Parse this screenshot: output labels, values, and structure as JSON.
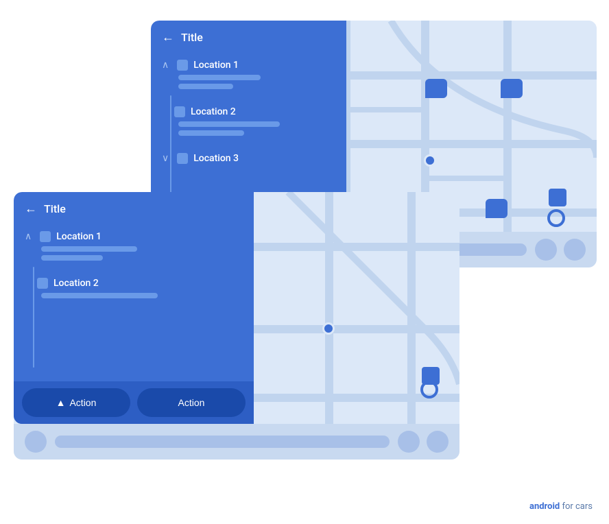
{
  "back_card": {
    "title": "Title",
    "panel": {
      "locations": [
        {
          "name": "Location 1",
          "bars": [
            120,
            80
          ],
          "expanded": true
        },
        {
          "name": "Location 2",
          "bars": [
            150,
            100
          ],
          "expanded": false
        },
        {
          "name": "Location 3",
          "bars": [],
          "expanded": false
        }
      ]
    }
  },
  "front_card": {
    "title": "Title",
    "panel": {
      "locations": [
        {
          "name": "Location 1",
          "bars": [
            130,
            85
          ],
          "expanded": true
        },
        {
          "name": "Location 2",
          "bars": [
            150,
            0
          ],
          "expanded": false
        }
      ]
    },
    "actions": [
      {
        "label": "Action",
        "has_icon": true
      },
      {
        "label": "Action",
        "has_icon": false
      }
    ]
  },
  "watermark": {
    "bold": "android",
    "rest": " for cars"
  },
  "nav_back": {
    "back_arrow": "←"
  },
  "nav_front": {
    "back_arrow": "←"
  }
}
